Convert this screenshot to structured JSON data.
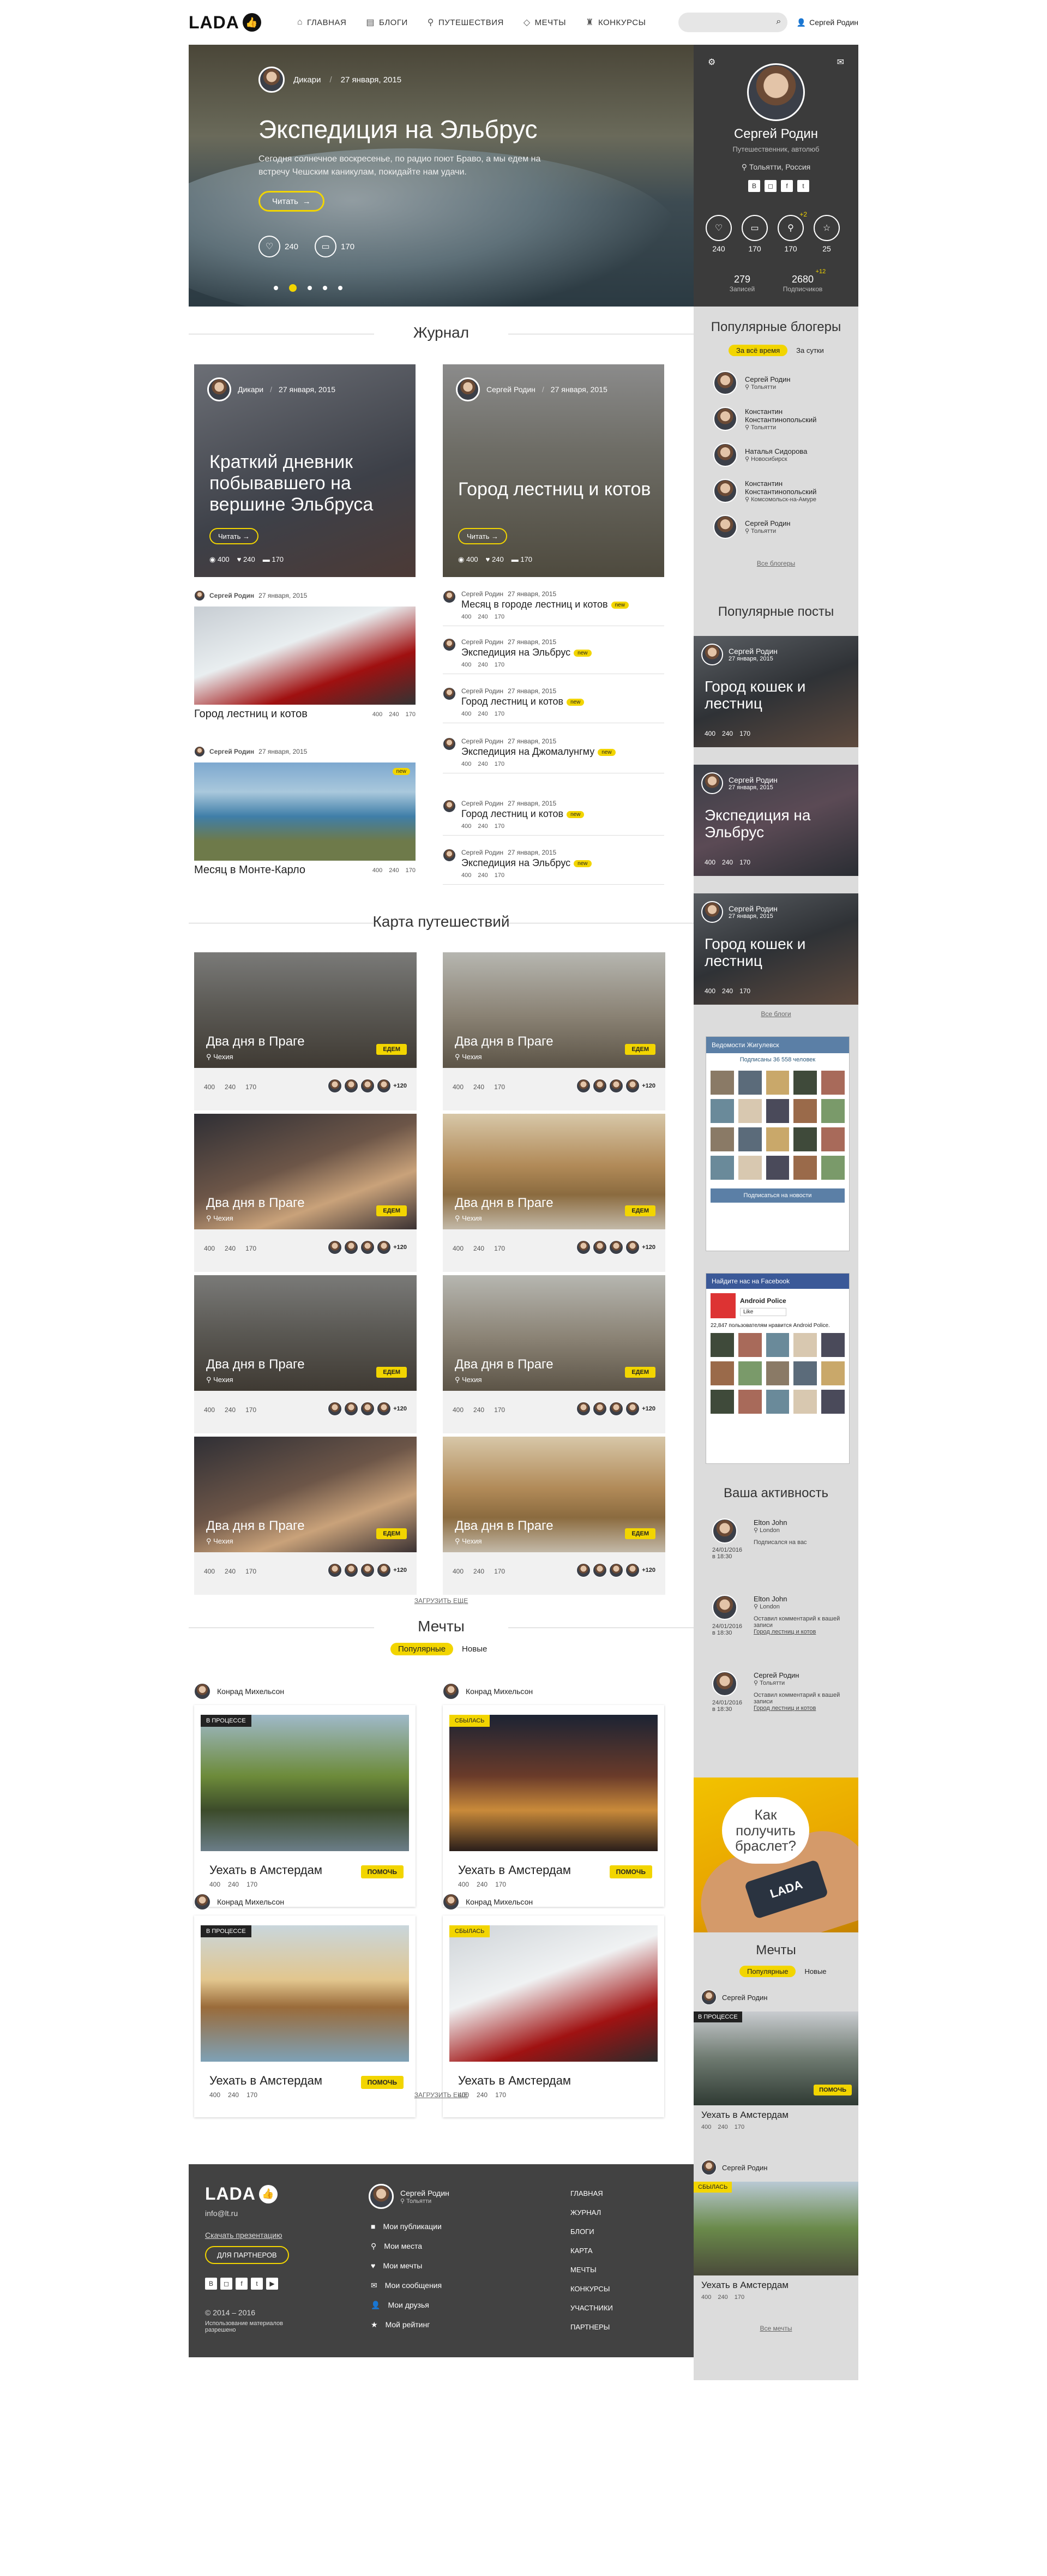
{
  "header": {
    "logo": "LADA",
    "nav": [
      {
        "label": "ГЛАВНАЯ",
        "icon": "home-icon"
      },
      {
        "label": "БЛОГИ",
        "icon": "doc-icon"
      },
      {
        "label": "ПУТЕШЕСТВИЯ",
        "icon": "pin-icon"
      },
      {
        "label": "МЕЧТЫ",
        "icon": "diamond-icon"
      },
      {
        "label": "КОНКУРСЫ",
        "icon": "trophy-icon"
      }
    ],
    "user": "Сергей Родин"
  },
  "hero": {
    "author": "Дикари",
    "date": "27 января, 2015",
    "title": "Экспедиция на Эльбрус",
    "text": "Сегодня солнечное воскресенье, по радио поют Браво, а мы едем на встречу Чешским каникулам, покидайте нам удачи.",
    "read": "Читать",
    "likes": "240",
    "comments": "170"
  },
  "profile": {
    "name": "Сергей Родин",
    "role": "Путешественник, автолюб",
    "location": "Тольятти, Россия",
    "socials": [
      "B",
      "◻",
      "f",
      "t"
    ],
    "stats": [
      {
        "value": "240",
        "icon": "heart-icon"
      },
      {
        "value": "170",
        "icon": "comment-icon"
      },
      {
        "value": "170",
        "icon": "pin-icon",
        "badge": "+2"
      },
      {
        "value": "25",
        "icon": "star-icon"
      }
    ],
    "posts_count": "279",
    "posts_label": "Записей",
    "subs_count": "2680",
    "subs_badge": "+12",
    "subs_label": "Подписчиков"
  },
  "journal": {
    "title": "Журнал",
    "big": [
      {
        "author": "Дикари",
        "date": "27 января, 2015",
        "title": "Краткий дневник побывавшего на вершине Эльбруса",
        "read": "Читать",
        "views": "400",
        "likes": "240",
        "comments": "170"
      },
      {
        "author": "Сергей Родин",
        "date": "27 января, 2015",
        "title": "Город лестниц и котов",
        "read": "Читать",
        "views": "400",
        "likes": "240",
        "comments": "170"
      }
    ],
    "photo_posts": [
      {
        "author": "Сергей Родин",
        "date": "27 января, 2015",
        "title": "Город лестниц и котов",
        "views": "400",
        "likes": "240",
        "comments": "170"
      },
      {
        "author": "Сергей Родин",
        "date": "27 января, 2015",
        "title": "Месяц в Монте-Карло",
        "views": "400",
        "likes": "240",
        "comments": "170",
        "tag": "new"
      }
    ],
    "list": [
      {
        "author": "Сергей Родин",
        "date": "27 января, 2015",
        "title": "Месяц в городе лестниц и котов",
        "tag": "new",
        "views": "400",
        "likes": "240",
        "comments": "170"
      },
      {
        "author": "Сергей Родин",
        "date": "27 января, 2015",
        "title": "Экспедиция на Эльбрус",
        "tag": "new",
        "views": "400",
        "likes": "240",
        "comments": "170"
      },
      {
        "author": "Сергей Родин",
        "date": "27 января, 2015",
        "title": "Город лестниц и котов",
        "tag": "new",
        "views": "400",
        "likes": "240",
        "comments": "170"
      },
      {
        "author": "Сергей Родин",
        "date": "27 января, 2015",
        "title": "Экспедиция на Джомалунгму",
        "tag": "new",
        "views": "400",
        "likes": "240",
        "comments": "170"
      },
      {
        "author": "Сергей Родин",
        "date": "27 января, 2015",
        "title": "Город лестниц и котов",
        "tag": "new",
        "views": "400",
        "likes": "240",
        "comments": "170"
      },
      {
        "author": "Сергей Родин",
        "date": "27 января, 2015",
        "title": "Экспедиция на Эльбрус",
        "tag": "new",
        "views": "400",
        "likes": "240",
        "comments": "170"
      }
    ]
  },
  "map": {
    "title": "Карта путешествий",
    "trips": [
      {
        "title": "Два дня в Праге",
        "loc": "Чехия",
        "go": "ЕДЕМ",
        "views": "400",
        "likes": "240",
        "comments": "170",
        "more": "+120"
      },
      {
        "title": "Два дня в Праге",
        "loc": "Чехия",
        "go": "ЕДЕМ",
        "views": "400",
        "likes": "240",
        "comments": "170",
        "more": "+120"
      },
      {
        "title": "Два дня в Праге",
        "loc": "Чехия",
        "go": "ЕДЕМ",
        "views": "400",
        "likes": "240",
        "comments": "170",
        "more": "+120"
      },
      {
        "title": "Два дня в Праге",
        "loc": "Чехия",
        "go": "ЕДЕМ",
        "views": "400",
        "likes": "240",
        "comments": "170",
        "more": "+120"
      },
      {
        "title": "Два дня в Праге",
        "loc": "Чехия",
        "go": "ЕДЕМ",
        "views": "400",
        "likes": "240",
        "comments": "170",
        "more": "+120"
      },
      {
        "title": "Два дня в Праге",
        "loc": "Чехия",
        "go": "ЕДЕМ",
        "views": "400",
        "likes": "240",
        "comments": "170",
        "more": "+120"
      },
      {
        "title": "Два дня в Праге",
        "loc": "Чехия",
        "go": "ЕДЕМ",
        "views": "400",
        "likes": "240",
        "comments": "170",
        "more": "+120"
      },
      {
        "title": "Два дня в Праге",
        "loc": "Чехия",
        "go": "ЕДЕМ",
        "views": "400",
        "likes": "240",
        "comments": "170",
        "more": "+120"
      }
    ],
    "more": "ЗАГРУЗИТЬ ЕЩЕ"
  },
  "dreams": {
    "title": "Мечты",
    "tab_popular": "Популярные",
    "tab_new": "Новые",
    "items": [
      {
        "author": "Конрад Михельсон",
        "status": "В ПРОЦЕССЕ",
        "title": "Уехать в Амстердам",
        "help": "ПОМОЧЬ",
        "views": "400",
        "likes": "240",
        "comments": "170"
      },
      {
        "author": "Конрад Михельсон",
        "status": "СБЫЛАСЬ",
        "title": "Уехать в Амстердам",
        "help": "ПОМОЧЬ",
        "views": "400",
        "likes": "240",
        "comments": "170"
      },
      {
        "author": "Конрад Михельсон",
        "status": "В ПРОЦЕССЕ",
        "title": "Уехать в Амстердам",
        "help": "ПОМОЧЬ",
        "views": "400",
        "likes": "240",
        "comments": "170"
      },
      {
        "author": "Конрад Михельсон",
        "status": "СБЫЛАСЬ",
        "title": "Уехать в Амстердам",
        "views": "400",
        "likes": "240",
        "comments": "170"
      }
    ],
    "more": "ЗАГРУЗИТЬ ЕЩЕ"
  },
  "footer": {
    "logo": "LADA",
    "email": "info@lt.ru",
    "download": "Скачать презентацию",
    "partners_btn": "ДЛЯ ПАРТНЕРОВ",
    "socials": [
      "B",
      "◻",
      "f",
      "t",
      "▶"
    ],
    "copyright": "© 2014 – 2016",
    "copy_note": "Использование материалов разрешено",
    "user": "Сергей Родин",
    "user_loc": "Тольятти",
    "links": [
      {
        "label": "Мои публикации",
        "icon": "chat-icon"
      },
      {
        "label": "Мои места",
        "icon": "pin-icon"
      },
      {
        "label": "Мои мечты",
        "icon": "heart-icon"
      },
      {
        "label": "Мои сообщения",
        "icon": "mail-icon"
      },
      {
        "label": "Мои друзья",
        "icon": "person-icon"
      },
      {
        "label": "Мой рейтинг",
        "icon": "star-icon"
      }
    ],
    "nav": [
      "ГЛАВНАЯ",
      "ЖУРНАЛ",
      "БЛОГИ",
      "КАРТА",
      "МЕЧТЫ",
      "КОНКУРСЫ",
      "УЧАСТНИКИ",
      "ПАРТНЕРЫ"
    ]
  },
  "sidebar": {
    "bloggers_title": "Популярные блогеры",
    "tab_all": "За всё время",
    "tab_day": "За сутки",
    "bloggers": [
      {
        "name": "Сергей Родин",
        "loc": "Тольятти"
      },
      {
        "name": "Константин Константинопольский",
        "loc": "Тольятти"
      },
      {
        "name": "Наталья Сидорова",
        "loc": "Новосибирск"
      },
      {
        "name": "Константин Константинопольский",
        "loc": "Комсомольск-на-Амуре"
      },
      {
        "name": "Сергей Родин",
        "loc": "Тольятти"
      }
    ],
    "all_bloggers": "Все блогеры",
    "posts_title": "Популярные посты",
    "posts": [
      {
        "author": "Сергей Родин",
        "date": "27 января, 2015",
        "title": "Город кошек и лестниц",
        "views": "400",
        "likes": "240",
        "comments": "170"
      },
      {
        "author": "Сергей Родин",
        "date": "27 января, 2015",
        "title": "Экспедиция на Эльбрус",
        "views": "400",
        "likes": "240",
        "comments": "170"
      },
      {
        "author": "Сергей Родин",
        "date": "27 января, 2015",
        "title": "Город кошек и лестниц",
        "views": "400",
        "likes": "240",
        "comments": "170"
      }
    ],
    "all_blogs": "Все блоги",
    "vk_title": "Ведомости Жигулевск",
    "vk_subs": "Подписаны 36 558 человек",
    "vk_button": "Подписаться на новости",
    "fb_header": "Найдите нас на Facebook",
    "fb_page": "Android Police",
    "fb_like": "Like",
    "fb_note": "22,847 пользователям нравится Android Police.",
    "activity_title": "Ваша активность",
    "activity": [
      {
        "name": "Elton John",
        "loc": "London",
        "date": "24/01/2016 в 18:30",
        "action": "Подписался на вас"
      },
      {
        "name": "Elton John",
        "loc": "London",
        "date": "24/01/2016 в 18:30",
        "action": "Оставил комментарий к вашей записи",
        "link": "Город лестниц и котов"
      },
      {
        "name": "Сергей Родин",
        "loc": "Тольятти",
        "date": "24/01/2016 в 18:30",
        "action": "Оставил комментарий к вашей записи",
        "link": "Город лестниц и котов"
      }
    ],
    "banner_text": "Как получить браслет?",
    "banner_brand": "LADA",
    "dreams_title": "Мечты",
    "dreams_tab_popular": "Популярные",
    "dreams_tab_new": "Новые",
    "dreams": [
      {
        "author": "Сергей Родин",
        "status": "В ПРОЦЕССЕ",
        "title": "Уехать в Амстердам",
        "help": "ПОМОЧЬ",
        "views": "400",
        "likes": "240",
        "comments": "170"
      },
      {
        "author": "Сергей Родин",
        "status": "СБЫЛАСЬ",
        "title": "Уехать в Амстердам",
        "views": "400",
        "likes": "240",
        "comments": "170"
      }
    ],
    "all_dreams": "Все мечты"
  }
}
